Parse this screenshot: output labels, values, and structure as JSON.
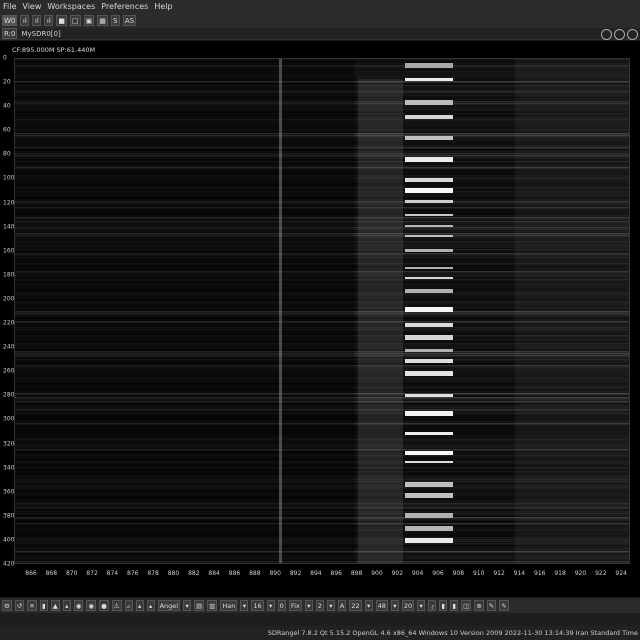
{
  "menu": [
    "File",
    "View",
    "Workspaces",
    "Preferences",
    "Help"
  ],
  "toolbar": {
    "buttons": [
      "W0",
      "ıl",
      "ıl",
      "ıl",
      "■",
      "□",
      "▣",
      "▦",
      "S",
      "AS"
    ]
  },
  "dock": {
    "device_button": "R:0",
    "device_name": "MySDR0[0]"
  },
  "waterfall": {
    "info": "CF:895.000M SP:61.440M",
    "y_ticks": [
      "0",
      "20",
      "40",
      "60",
      "80",
      "100",
      "120",
      "140",
      "160",
      "180",
      "200",
      "220",
      "240",
      "260",
      "280",
      "300",
      "320",
      "340",
      "360",
      "380",
      "400",
      "420"
    ],
    "x_ticks": [
      "866",
      "868",
      "870",
      "872",
      "874",
      "876",
      "878",
      "880",
      "882",
      "884",
      "886",
      "888",
      "890",
      "892",
      "894",
      "896",
      "898",
      "900",
      "902",
      "904",
      "906",
      "908",
      "910",
      "912",
      "914",
      "916",
      "918",
      "920",
      "922",
      "924"
    ]
  },
  "bottom_toolbar": {
    "items": [
      "⚙",
      "↺",
      "✕",
      "▮",
      "▲",
      "▴",
      "◉",
      "◉",
      "●",
      "⚠",
      "▵",
      "▴",
      "▴",
      "Angel",
      "▾",
      "▤",
      "▥",
      "Han",
      "▾",
      "16",
      "▾",
      "0",
      "Fix",
      "▾",
      "2",
      "▾",
      "A",
      "22",
      "▾",
      "48",
      "▾",
      "20",
      "▾",
      "╭",
      "▮",
      "▮",
      "◫",
      "⊕",
      "✎",
      "✎"
    ]
  },
  "status": "SDRangel 7.8.2 Qt 5.15.2 OpenGL 4.6 x86_64 Windows 10 Version 2009 2022-11-30 13:14:39 Iran Standard Time"
}
